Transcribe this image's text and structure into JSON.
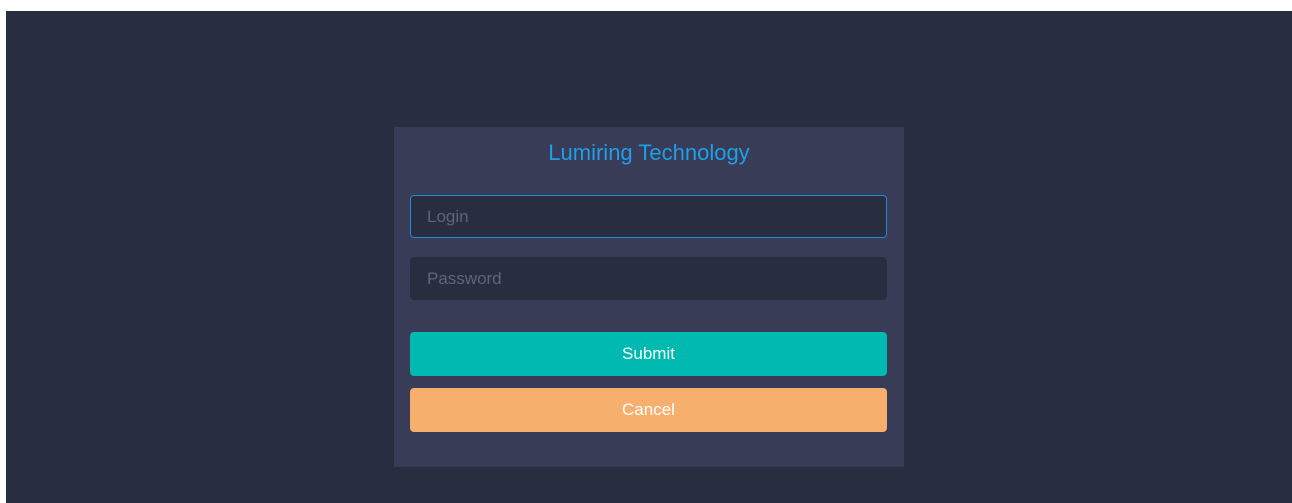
{
  "app": {
    "title": "Lumiring Technology"
  },
  "form": {
    "login_placeholder": "Login",
    "login_value": "",
    "password_placeholder": "Password",
    "password_value": "",
    "submit_label": "Submit",
    "cancel_label": "Cancel"
  },
  "colors": {
    "page_background": "#282e3f",
    "panel_background": "#383c57",
    "title_color": "#1e9fe8",
    "focus_border": "#1b8fd3",
    "submit_button": "#00b9b0",
    "cancel_button": "#f6af6c"
  }
}
